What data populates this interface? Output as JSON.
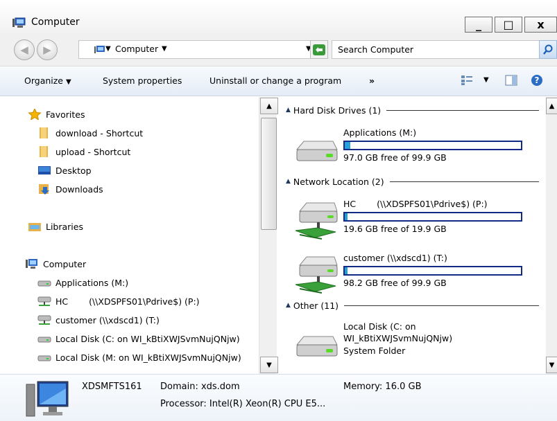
{
  "window": {
    "title": "Computer",
    "minimize": "_",
    "maximize": "□",
    "close": "x"
  },
  "address": {
    "location": "Computer",
    "search_placeholder": "Search Computer"
  },
  "toolbar": {
    "organize": "Organize",
    "system_properties": "System properties",
    "uninstall": "Uninstall or change a program",
    "more": "»"
  },
  "nav": {
    "favorites": "Favorites",
    "download_shortcut": "download - Shortcut",
    "upload_shortcut": "upload - Shortcut",
    "desktop": "Desktop",
    "downloads": "Downloads",
    "libraries": "Libraries",
    "computer": "Computer",
    "drives": [
      "Applications (M:)",
      "HC            (\\\\XDSPFS01\\Pdrive$) (P:)",
      "customer (\\\\xdscd1) (T:)",
      "Local Disk (C: on WI_kBtiXWJSvmNujQNjw)",
      "Local Disk (M: on WI_kBtiXWJSvmNujQNjw)"
    ]
  },
  "content": {
    "groups": {
      "hdd": "Hard Disk Drives (1)",
      "network": "Network Location (2)",
      "other": "Other (11)"
    },
    "items": {
      "applications": {
        "name": "Applications (M:)",
        "free": "97.0 GB free of 99.9 GB",
        "used_fraction": 0.03
      },
      "pdrive": {
        "name": "HC            (\\\\XDSPFS01\\Pdrive$) (P:)",
        "free": "19.6 GB free of 19.9 GB",
        "used_fraction": 0.015
      },
      "customer": {
        "name": "customer (\\\\xdscd1) (T:)",
        "free": "98.2 GB free of 99.9 GB",
        "used_fraction": 0.017
      },
      "localc": {
        "name": "Local Disk (C: on",
        "name2": "WI_kBtiXWJSvmNujQNjw)",
        "sub": "System Folder"
      }
    }
  },
  "details": {
    "computer_name": "XDSMFTS161",
    "domain": "Domain: xds.dom",
    "memory": "Memory: 16.0 GB",
    "processor": "Processor: Intel(R) Xeon(R) CPU E5..."
  },
  "colors": {
    "progress_border": "#112a86",
    "progress_fill": "#26a0da",
    "toolbar_bg": "#e4ecf6"
  }
}
